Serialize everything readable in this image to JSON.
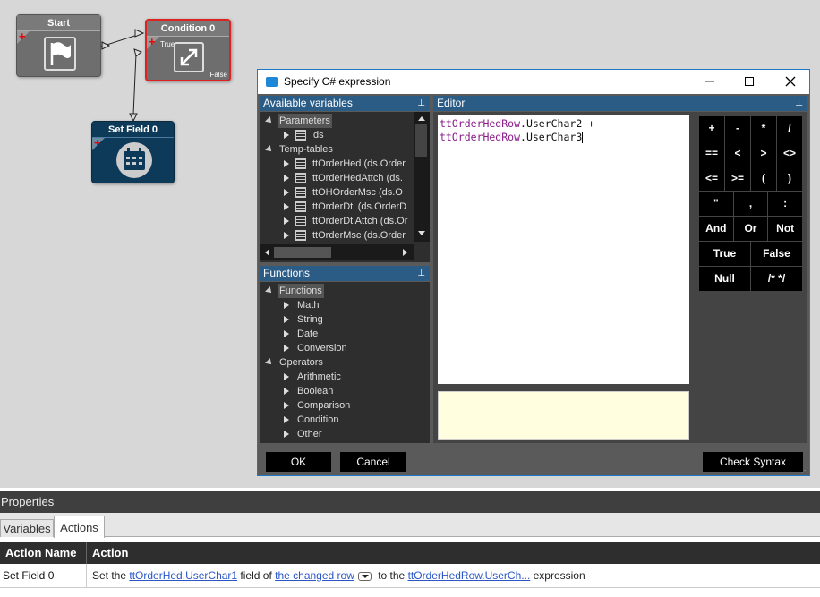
{
  "nodes": {
    "start": {
      "title": "Start",
      "icon": "flag-icon"
    },
    "condition": {
      "title": "Condition 0",
      "true_label": "True",
      "false_label": "False",
      "icon": "arrows-icon"
    },
    "setfield": {
      "title": "Set Field 0",
      "icon": "calendar-icon"
    }
  },
  "dialog": {
    "title": "Specify C# expression",
    "vars_header": "Available variables",
    "vars_tree": {
      "parameters": "Parameters",
      "ds": "ds",
      "temp_tables": "Temp-tables",
      "tables": [
        "ttOrderHed (ds.Order",
        "ttOrderHedAttch (ds.",
        "ttOHOrderMsc (ds.O",
        "ttOrderDtl (ds.OrderD",
        "ttOrderDtlAttch (ds.Or",
        "ttOrderMsc (ds.Order"
      ]
    },
    "functions_header": "Functions",
    "functions_tree": {
      "functions": "Functions",
      "function_items": [
        "Math",
        "String",
        "Date",
        "Conversion"
      ],
      "operators": "Operators",
      "operator_items": [
        "Arithmetic",
        "Boolean",
        "Comparison",
        "Condition",
        "Other"
      ]
    },
    "editor_header": "Editor",
    "editor": {
      "line1_var": "ttOrderHedRow",
      "line1_rest": ".UserChar2 +",
      "line2_var": "ttOrderHedRow",
      "line2_rest": ".UserChar3"
    },
    "keypad": [
      "+",
      "-",
      "*",
      "/",
      "==",
      "<",
      ">",
      "<>",
      "<=",
      ">=",
      "(",
      ")",
      "\"",
      ",",
      ":",
      "And",
      "Or",
      "Not",
      "True",
      "False",
      "Null",
      "/* */"
    ],
    "ok_label": "OK",
    "cancel_label": "Cancel",
    "check_syntax_label": "Check Syntax"
  },
  "properties": {
    "title": "Properties",
    "tabs": [
      "Variables",
      "Actions"
    ],
    "active_tab": "Actions",
    "columns": [
      "Action Name",
      "Action"
    ],
    "row": {
      "name": "Set Field 0",
      "t1": "Set the ",
      "l1": "ttOrderHed.UserChar1",
      "t2": " field of ",
      "l2": "the changed row",
      "t3": " to the ",
      "l3": "ttOrderHedRow.UserCh...",
      "t4": " expression"
    }
  },
  "colors": {
    "accent": "#1e78c8",
    "panel_header": "#2b5c86",
    "node_dark": "#0e3a5a",
    "node_gray": "#6e6e6e",
    "editor_var": "#8a1a8a"
  }
}
